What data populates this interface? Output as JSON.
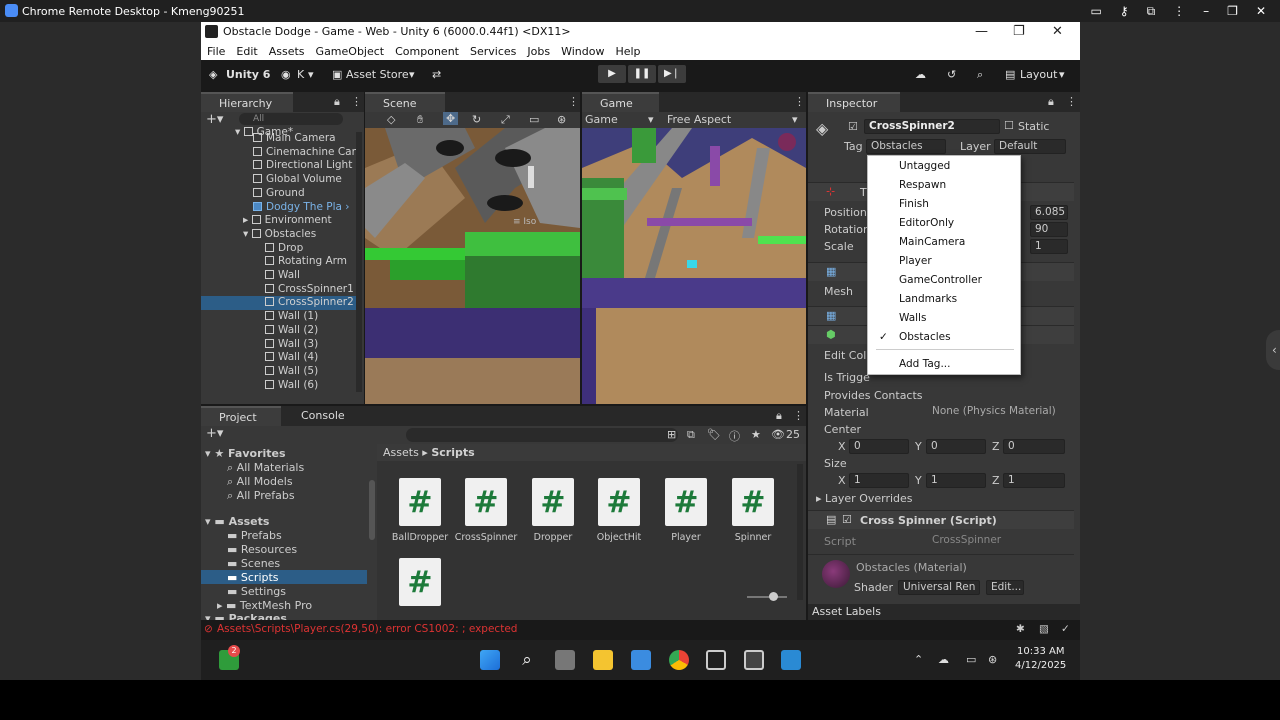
{
  "remote": {
    "title": "Chrome Remote Desktop - Kmeng90251"
  },
  "window": {
    "title": "Obstacle Dodge - Game - Web - Unity 6 (6000.0.44f1) <DX11>"
  },
  "menu": [
    "File",
    "Edit",
    "Assets",
    "GameObject",
    "Component",
    "Services",
    "Jobs",
    "Window",
    "Help"
  ],
  "toolbar": {
    "unity_label": "Unity 6",
    "account": "K",
    "asset_store": "Asset Store",
    "layout": "Layout"
  },
  "hierarchy": {
    "tab": "Hierarchy",
    "search_placeholder": "All",
    "items": [
      {
        "label": "Game*",
        "level": 0
      },
      {
        "label": "Main Camera",
        "level": 1
      },
      {
        "label": "Cinemachine Can",
        "level": 1
      },
      {
        "label": "Directional Light",
        "level": 1
      },
      {
        "label": "Global Volume",
        "level": 1
      },
      {
        "label": "Ground",
        "level": 1
      },
      {
        "label": "Dodgy The Pla",
        "level": 1
      },
      {
        "label": "Environment",
        "level": 1
      },
      {
        "label": "Obstacles",
        "level": 1
      },
      {
        "label": "Drop",
        "level": 2
      },
      {
        "label": "Rotating Arm",
        "level": 2
      },
      {
        "label": "Wall",
        "level": 2
      },
      {
        "label": "CrossSpinner1",
        "level": 2
      },
      {
        "label": "CrossSpinner2",
        "level": 2
      },
      {
        "label": "Wall (1)",
        "level": 2
      },
      {
        "label": "Wall (2)",
        "level": 2
      },
      {
        "label": "Wall (3)",
        "level": 2
      },
      {
        "label": "Wall (4)",
        "level": 2
      },
      {
        "label": "Wall (5)",
        "level": 2
      },
      {
        "label": "Wall (6)",
        "level": 2
      }
    ]
  },
  "scene": {
    "tab": "Scene",
    "iso_label": "≡ Iso"
  },
  "game": {
    "tab": "Game",
    "display": "Game",
    "aspect": "Free Aspect"
  },
  "inspector": {
    "tab": "Inspector",
    "object_name": "CrossSpinner2",
    "static_label": "Static",
    "tag_label": "Tag",
    "tag_value": "Obstacles",
    "layer_label": "Layer",
    "layer_value": "Default",
    "position_label": "Position",
    "rotation_label": "Rotation",
    "scale_label": "Scale",
    "position_z": "6.085",
    "rotation_z": "90",
    "scale_z": "1",
    "mesh_label": "Mesh",
    "edit_collider": "Edit Coll",
    "is_trigger": "Is Trigge",
    "provides_contacts": "Provides Contacts",
    "material_label": "Material",
    "material_value": "None (Physics Material)",
    "center_label": "Center",
    "center": {
      "x": "0",
      "y": "0",
      "z": "0"
    },
    "size_label": "Size",
    "size": {
      "x": "1",
      "y": "1",
      "z": "1"
    },
    "layer_overrides": "Layer Overrides",
    "script_comp": "Cross Spinner (Script)",
    "script_label": "Script",
    "script_value": "CrossSpinner",
    "material_comp": "Obstacles (Material)",
    "shader_label": "Shader",
    "shader_value": "Universal Ren",
    "edit_btn": "Edit...",
    "asset_labels": "Asset Labels"
  },
  "tag_dropdown": {
    "items": [
      "Untagged",
      "Respawn",
      "Finish",
      "EditorOnly",
      "MainCamera",
      "Player",
      "GameController",
      "Landmarks",
      "Walls",
      "Obstacles"
    ],
    "checked": "Obstacles",
    "add": "Add Tag..."
  },
  "project": {
    "tab_project": "Project",
    "tab_console": "Console",
    "count": "25",
    "breadcrumb_root": "Assets",
    "breadcrumb_current": "Scripts",
    "favorites_label": "Favorites",
    "favorites": [
      "All Materials",
      "All Models",
      "All Prefabs"
    ],
    "assets_label": "Assets",
    "assets": [
      "Prefabs",
      "Resources",
      "Scenes",
      "Scripts",
      "Settings",
      "TextMesh Pro"
    ],
    "packages_label": "Packages",
    "scripts": [
      "BallDropper",
      "CrossSpinner",
      "Dropper",
      "ObjectHit",
      "Player",
      "Spinner"
    ]
  },
  "status": {
    "error": "Assets\\Scripts\\Player.cs(29,50): error CS1002: ; expected"
  },
  "taskbar": {
    "time": "10:33 AM",
    "date": "4/12/2025",
    "badge": "2"
  }
}
